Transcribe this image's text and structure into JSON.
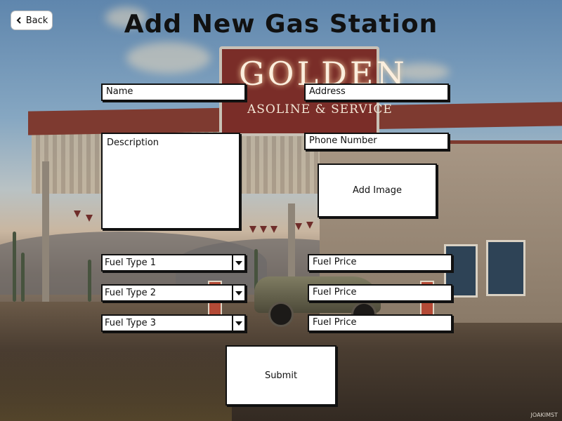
{
  "header": {
    "back_label": "Back",
    "title": "Add New Gas Station"
  },
  "background": {
    "sign_main": "GOLDEN",
    "sign_sub": "ASOLINE & SERVICE",
    "watermark": "JOAKIMST"
  },
  "form": {
    "name_placeholder": "Name",
    "address_placeholder": "Address",
    "description_placeholder": "Description",
    "phone_placeholder": "Phone Number",
    "add_image_label": "Add Image",
    "fuel_rows": [
      {
        "type_label": "Fuel Type 1",
        "price_placeholder": "Fuel Price"
      },
      {
        "type_label": "Fuel Type 2",
        "price_placeholder": "Fuel Price"
      },
      {
        "type_label": "Fuel Type 3",
        "price_placeholder": "Fuel Price"
      }
    ],
    "submit_label": "Submit"
  },
  "icons": {
    "back": "chevron-left-icon",
    "dropdown": "caret-down-icon"
  },
  "colors": {
    "ink": "#111111",
    "field_bg": "#ffffff"
  }
}
